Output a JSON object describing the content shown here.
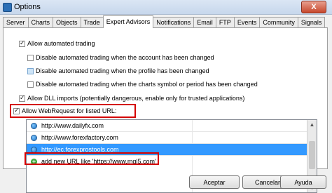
{
  "window": {
    "title": "Options",
    "close_label": "X"
  },
  "tabs": [
    {
      "label": "Server"
    },
    {
      "label": "Charts"
    },
    {
      "label": "Objects"
    },
    {
      "label": "Trade"
    },
    {
      "label": "Expert Advisors"
    },
    {
      "label": "Notifications"
    },
    {
      "label": "Email"
    },
    {
      "label": "FTP"
    },
    {
      "label": "Events"
    },
    {
      "label": "Community"
    },
    {
      "label": "Signals"
    }
  ],
  "active_tab": "Expert Advisors",
  "options": {
    "allow_automated_trading": {
      "label": "Allow automated trading",
      "checked": true
    },
    "disable_account_changed": {
      "label": "Disable automated trading when the account has been changed",
      "checked": false
    },
    "disable_profile_changed": {
      "label": "Disable automated trading when the profile has been changed",
      "checked": false
    },
    "disable_symbol_changed": {
      "label": "Disable automated trading when the charts symbol or period has been changed",
      "checked": false
    },
    "allow_dll_imports": {
      "label": "Allow DLL imports (potentially dangerous, enable only for trusted applications)",
      "checked": true
    },
    "allow_webrequest": {
      "label": "Allow WebRequest for listed URL:",
      "checked": true
    }
  },
  "url_list": {
    "items": [
      {
        "url": "http://www.dailyfx.com",
        "selected": false
      },
      {
        "url": "http://www.forexfactory.com",
        "selected": false
      },
      {
        "url": "http://ec.forexprostools.com",
        "selected": true
      }
    ],
    "add_new": "add new URL like 'https://www.mql5.com'"
  },
  "buttons": {
    "ok": "Aceptar",
    "cancel": "Cancelar",
    "help": "Ayuda"
  },
  "colors": {
    "highlight": "#d40000",
    "selection": "#3399ff"
  }
}
